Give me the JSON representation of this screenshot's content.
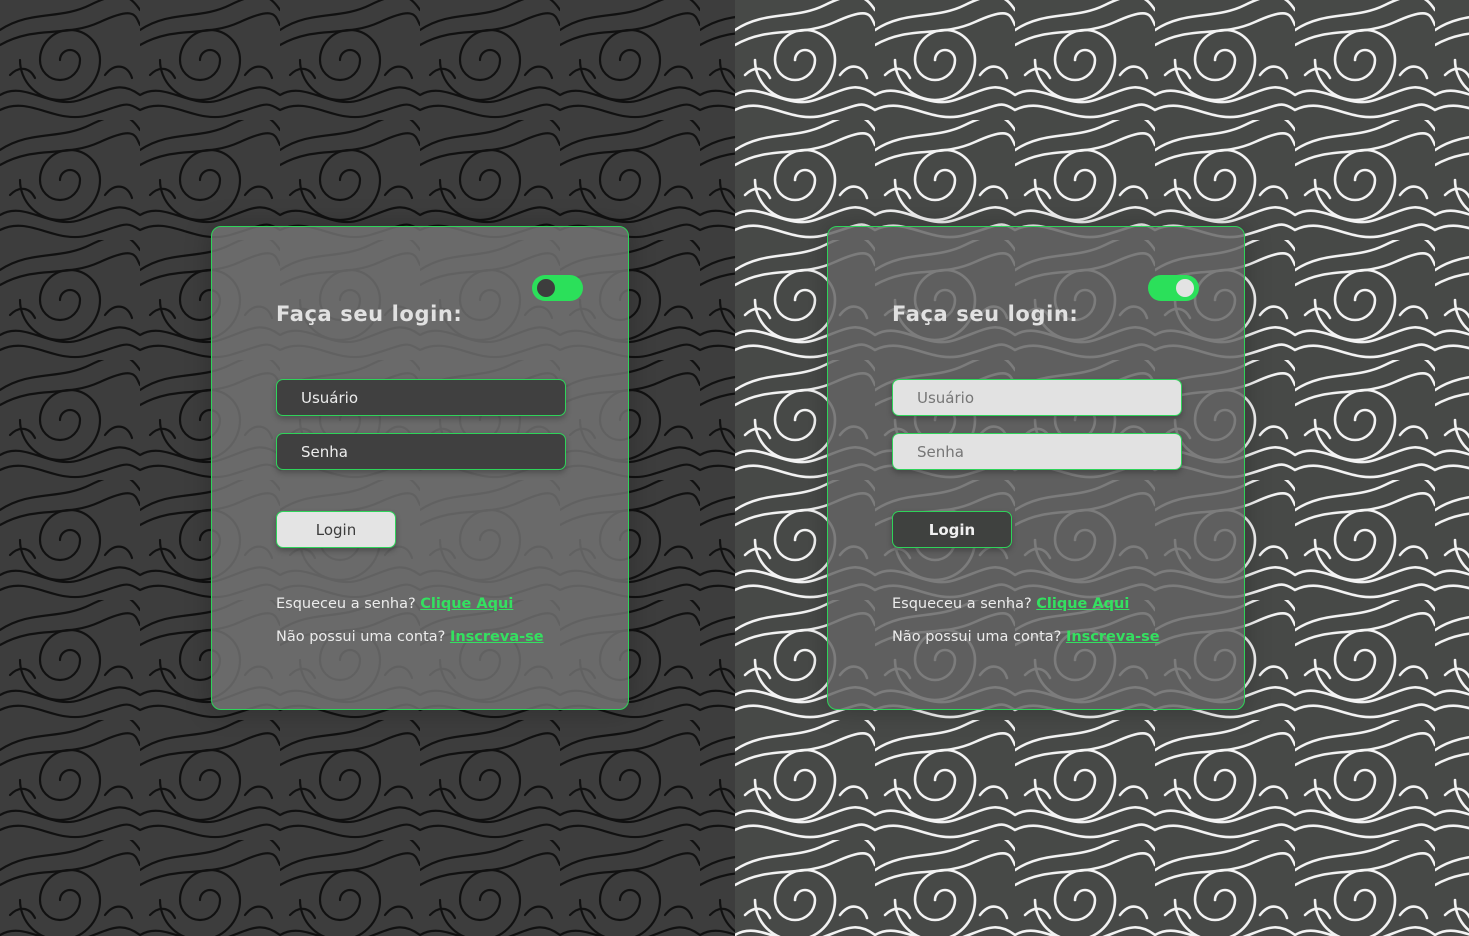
{
  "panels": [
    {
      "theme": "dark",
      "title": "Faça seu login:",
      "username_placeholder": "Usuário",
      "password_placeholder": "Senha",
      "login_label": "Login",
      "forgot_text": "Esqueceu a senha?",
      "forgot_link": "Clique Aqui",
      "signup_text": "Não possui uma conta?",
      "signup_link": "Inscreva-se"
    },
    {
      "theme": "light",
      "title": "Faça seu login:",
      "username_placeholder": "Usuário",
      "password_placeholder": "Senha",
      "login_label": "Login",
      "forgot_text": "Esqueceu a senha?",
      "forgot_link": "Clique Aqui",
      "signup_text": "Não possui uma conta?",
      "signup_link": "Inscreva-se"
    }
  ],
  "colors": {
    "accent": "#2be05a",
    "link": "#34e060",
    "dark_background": "#3d3d3d",
    "light_background": "#474947"
  }
}
